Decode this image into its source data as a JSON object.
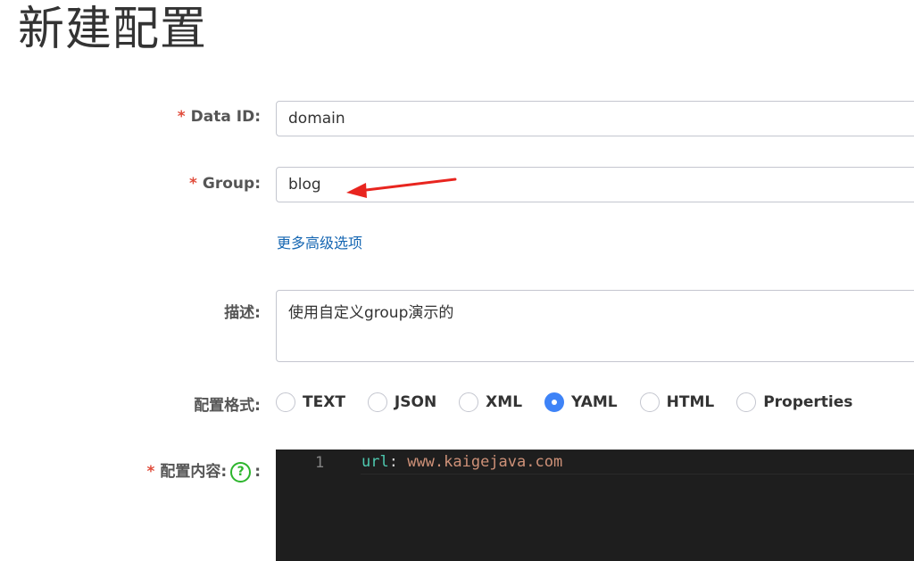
{
  "page": {
    "title": "新建配置"
  },
  "form": {
    "data_id": {
      "required_mark": "*",
      "label": "Data ID:",
      "value": "domain"
    },
    "group": {
      "required_mark": "*",
      "label": "Group:",
      "value": "blog"
    },
    "advanced_link": "更多高级选项",
    "description": {
      "label": "描述:",
      "value": "使用自定义group演示的"
    },
    "format": {
      "label": "配置格式:",
      "options": [
        "TEXT",
        "JSON",
        "XML",
        "YAML",
        "HTML",
        "Properties"
      ],
      "selected": "YAML"
    },
    "content": {
      "required_mark": "*",
      "label": "配置内容:",
      "help_glyph": "?",
      "colon": ":",
      "line_number": "1",
      "code_key": "url",
      "code_sep": ": ",
      "code_value": "www.kaigejava.com"
    }
  },
  "colors": {
    "required": "#e04b3a",
    "link": "#1566b2",
    "radio_selected": "#3e83f7",
    "help_icon": "#2db52d",
    "editor_bg": "#1e1e1e",
    "annotation_arrow": "#e8251f"
  },
  "icons": {
    "help": "question-circle-icon",
    "annotation": "red-arrow-annotation"
  }
}
